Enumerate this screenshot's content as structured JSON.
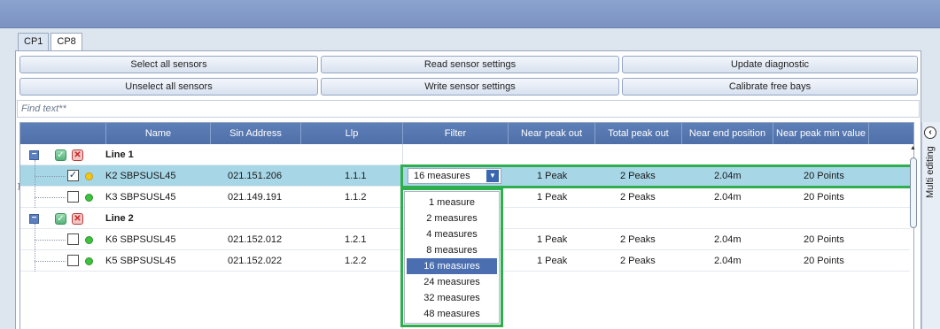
{
  "tabs": [
    {
      "label": "CP1",
      "active": false
    },
    {
      "label": "CP8",
      "active": true
    }
  ],
  "buttons": {
    "row1": [
      "Select all sensors",
      "Read sensor settings",
      "Update diagnostic"
    ],
    "row2": [
      "Unselect all sensors",
      "Write sensor settings",
      "Calibrate free bays"
    ]
  },
  "find_placeholder": "Find text**",
  "columns": [
    "Name",
    "Sin Address",
    "Llp",
    "Filter",
    "Near peak out",
    "Total peak out",
    "Near end position",
    "Near peak min value"
  ],
  "groups": [
    {
      "name": "Line 1",
      "rows": [
        {
          "name": "K2 SBPSUSL45",
          "sin": "021.151.206",
          "llp": "1.1.1",
          "filter": "16 measures",
          "near_peak": "1 Peak",
          "total_peak": "2 Peaks",
          "near_end": "2.04m",
          "near_peak_min": "20 Points",
          "checked": true,
          "status": "yellow",
          "selected": true
        },
        {
          "name": "K3 SBPSUSL45",
          "sin": "021.149.191",
          "llp": "1.1.2",
          "filter": "",
          "near_peak": "1 Peak",
          "total_peak": "2 Peaks",
          "near_end": "2.04m",
          "near_peak_min": "20 Points",
          "checked": false,
          "status": "green",
          "selected": false
        }
      ]
    },
    {
      "name": "Line 2",
      "rows": [
        {
          "name": "K6 SBPSUSL45",
          "sin": "021.152.012",
          "llp": "1.2.1",
          "filter": "",
          "near_peak": "1 Peak",
          "total_peak": "2 Peaks",
          "near_end": "2.04m",
          "near_peak_min": "20 Points",
          "checked": false,
          "status": "green",
          "selected": false
        },
        {
          "name": "K5 SBPSUSL45",
          "sin": "021.152.022",
          "llp": "1.2.2",
          "filter": "",
          "near_peak": "1 Peak",
          "total_peak": "2 Peaks",
          "near_end": "2.04m",
          "near_peak_min": "20 Points",
          "checked": false,
          "status": "green",
          "selected": false
        }
      ]
    }
  ],
  "filter_options": [
    "1 measure",
    "2 measures",
    "4 measures",
    "8 measures",
    "16 measures",
    "24 measures",
    "32 measures",
    "48 measures"
  ],
  "filter_selected": "16 measures",
  "side_panel_label": "Multi editing",
  "colors": {
    "header": "#5d7fb8",
    "highlight": "#2eae4d",
    "selected_row": "#a7d6e6",
    "status_green": "#3ec23e",
    "status_yellow": "#f5c518"
  }
}
